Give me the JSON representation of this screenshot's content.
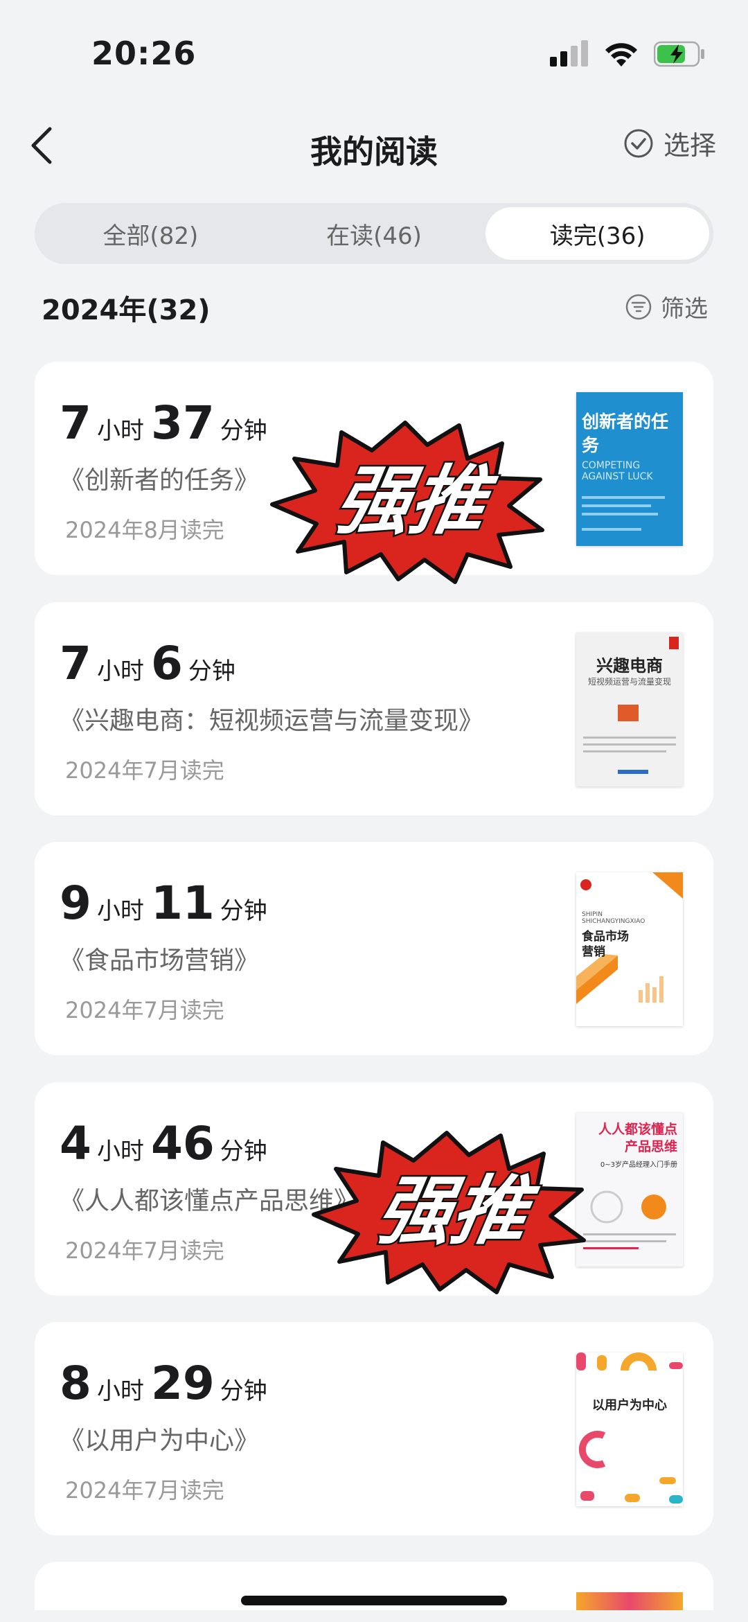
{
  "status": {
    "time": "20:26"
  },
  "nav": {
    "title": "我的阅读",
    "select_label": "选择"
  },
  "tabs": [
    {
      "label": "全部(82)",
      "active": false
    },
    {
      "label": "在读(46)",
      "active": false
    },
    {
      "label": "读完(36)",
      "active": true
    }
  ],
  "section": {
    "year_label": "2024年(32)",
    "filter_label": "筛选"
  },
  "books": [
    {
      "hours": "7",
      "minutes": "37",
      "hour_unit": "小时",
      "minute_unit": "分钟",
      "title": "《创新者的任务》",
      "date": "2024年8月读完",
      "cover_title": "创新者的任务",
      "cover_subtitle": "COMPETING AGAINST LUCK",
      "badge": "强推"
    },
    {
      "hours": "7",
      "minutes": "6",
      "hour_unit": "小时",
      "minute_unit": "分钟",
      "title": "《兴趣电商：短视频运营与流量变现》",
      "date": "2024年7月读完",
      "cover_title": "兴趣电商",
      "cover_subtitle": "短视频运营与流量变现"
    },
    {
      "hours": "9",
      "minutes": "11",
      "hour_unit": "小时",
      "minute_unit": "分钟",
      "title": "《食品市场营销》",
      "date": "2024年7月读完",
      "cover_title": "食品市场营销",
      "cover_subtitle": "SHIPIN SHICHANGYINGXIAO"
    },
    {
      "hours": "4",
      "minutes": "46",
      "hour_unit": "小时",
      "minute_unit": "分钟",
      "title": "《人人都该懂点产品思维》",
      "date": "2024年7月读完",
      "cover_title": "人人都该懂点产品思维",
      "cover_subtitle": "0~3岁产品经理入门手册",
      "badge": "强推"
    },
    {
      "hours": "8",
      "minutes": "29",
      "hour_unit": "小时",
      "minute_unit": "分钟",
      "title": "《以用户为中心》",
      "date": "2024年7月读完",
      "cover_title": "以用户为中心",
      "cover_subtitle": ""
    }
  ],
  "colors": {
    "accent": "#1c1c1e",
    "badge_red": "#d9251d",
    "battery_green": "#3cc24a"
  }
}
